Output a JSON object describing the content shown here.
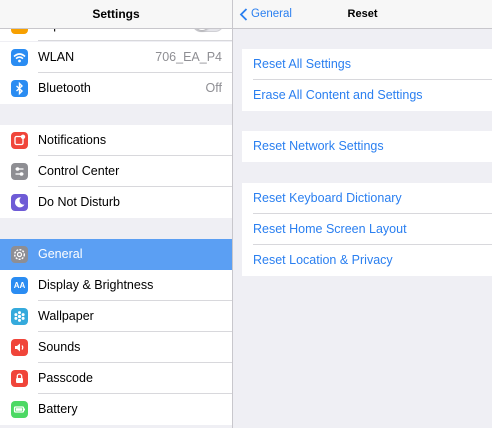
{
  "left": {
    "title": "Settings",
    "airplane": {
      "label": "Airplane Mode"
    },
    "group1": [
      {
        "label": "WLAN",
        "value": "706_EA_P4",
        "icon": "wifi-icon",
        "color": "#2a8cf2"
      },
      {
        "label": "Bluetooth",
        "value": "Off",
        "icon": "bluetooth-icon",
        "color": "#2a8cf2"
      }
    ],
    "group2": [
      {
        "label": "Notifications",
        "icon": "notifications-icon",
        "color": "#f0453a"
      },
      {
        "label": "Control Center",
        "icon": "control-center-icon",
        "color": "#8e8e93"
      },
      {
        "label": "Do Not Disturb",
        "icon": "moon-icon",
        "color": "#6e5bd6"
      }
    ],
    "group3": [
      {
        "label": "General",
        "icon": "gear-icon",
        "color": "#8e8e93",
        "selected": true
      },
      {
        "label": "Display & Brightness",
        "icon": "display-icon",
        "color": "#2a8cf2"
      },
      {
        "label": "Wallpaper",
        "icon": "wallpaper-icon",
        "color": "#35aadc"
      },
      {
        "label": "Sounds",
        "icon": "sounds-icon",
        "color": "#f0453a"
      },
      {
        "label": "Passcode",
        "icon": "lock-icon",
        "color": "#f0453a"
      },
      {
        "label": "Battery",
        "icon": "battery-icon",
        "color": "#4cd964"
      }
    ]
  },
  "right": {
    "back_label": "General",
    "title": "Reset",
    "group1": [
      "Reset All Settings",
      "Erase All Content and Settings"
    ],
    "group2": [
      "Reset Network Settings"
    ],
    "group3": [
      "Reset Keyboard Dictionary",
      "Reset Home Screen Layout",
      "Reset Location & Privacy"
    ]
  },
  "colors": {
    "accent": "#2a7ff0",
    "selected_bg": "#5b9ff3",
    "background": "#efeff4"
  }
}
